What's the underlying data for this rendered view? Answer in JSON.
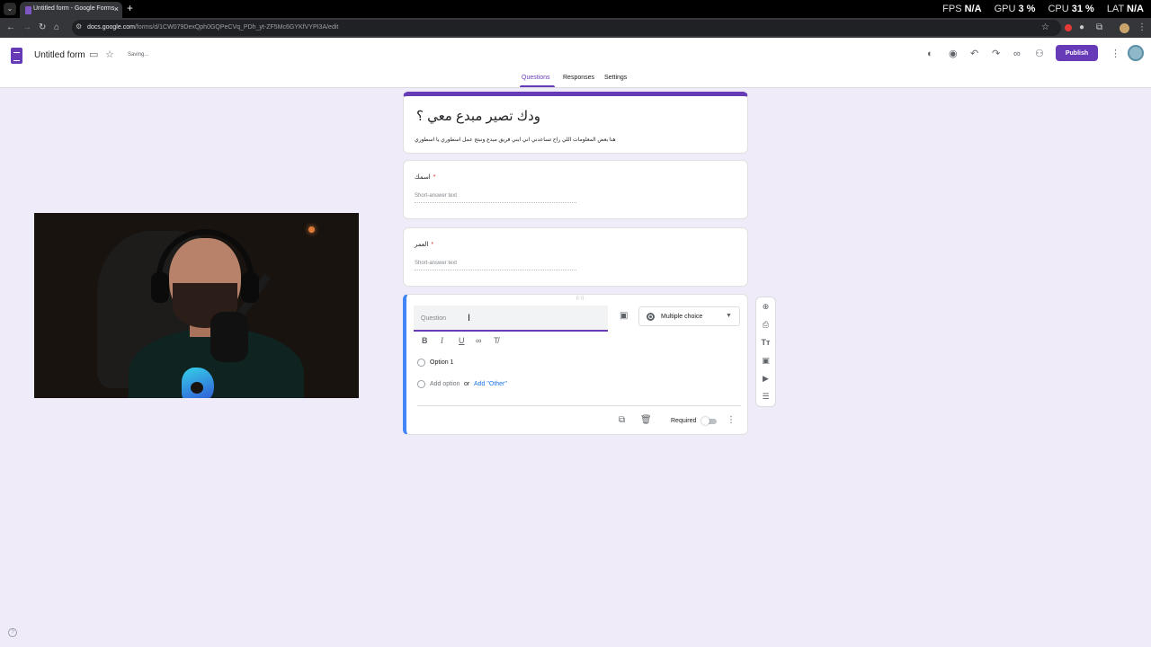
{
  "browser": {
    "tab_title": "Untitled form - Google Forms",
    "url_domain": "docs.google.com",
    "url_path": "/forms/d/1CW079DexQph0GQPeCVq_PDh_yt-ZF5Mc6GYKfVYPI3A/edit",
    "icons": {
      "menu": "chevron-down-icon",
      "close": "close-icon",
      "new_tab": "plus-icon",
      "back": "back-arrow-icon",
      "forward": "forward-arrow-icon",
      "reload": "reload-icon",
      "home": "home-icon",
      "site_info": "tune-icon",
      "bookmark": "star-icon",
      "extensions": "puzzle-icon",
      "menu_more": "kebab-icon"
    }
  },
  "overlay_stats": {
    "fps_label": "FPS",
    "fps_value": "N/A",
    "gpu_label": "GPU",
    "gpu_value": "3 %",
    "cpu_label": "CPU",
    "cpu_value": "31 %",
    "lat_label": "LAT",
    "lat_value": "N/A"
  },
  "header": {
    "doc_title": "Untitled form",
    "saving": "Saving...",
    "publish_label": "Publish",
    "icons": [
      "palette-icon",
      "preview-eye-icon",
      "undo-icon",
      "redo-icon",
      "link-icon",
      "add-collaborator-icon",
      "more-vert-icon"
    ]
  },
  "nav_tabs": [
    "Questions",
    "Responses",
    "Settings"
  ],
  "active_tab": "Questions",
  "form": {
    "title": "ودك تصير مبدع معي ؟",
    "description": "هنا بعض المعلومات اللي راح تساعدني اني ابني فريق مبدع ونبتج عمل اسطوري يا اسطوري",
    "questions": [
      {
        "label": "اسمك",
        "required_mark": "*",
        "placeholder": "Short-answer text"
      },
      {
        "label": "العمر",
        "required_mark": "*",
        "placeholder": "Short-answer text"
      }
    ],
    "active_question": {
      "placeholder": "Question",
      "type": "Multiple choice",
      "option_1": "Option 1",
      "add_option": "Add option",
      "or": "or",
      "add_other": "Add \"Other\"",
      "required_label": "Required",
      "required_on": false
    }
  },
  "side_toolbar": [
    "add-question-icon",
    "import-questions-icon",
    "add-title-icon",
    "add-image-icon",
    "add-video-icon",
    "add-section-icon"
  ],
  "colors": {
    "accent": "#673ab7",
    "background": "#f0ebf8",
    "active_border": "#4285f4"
  }
}
